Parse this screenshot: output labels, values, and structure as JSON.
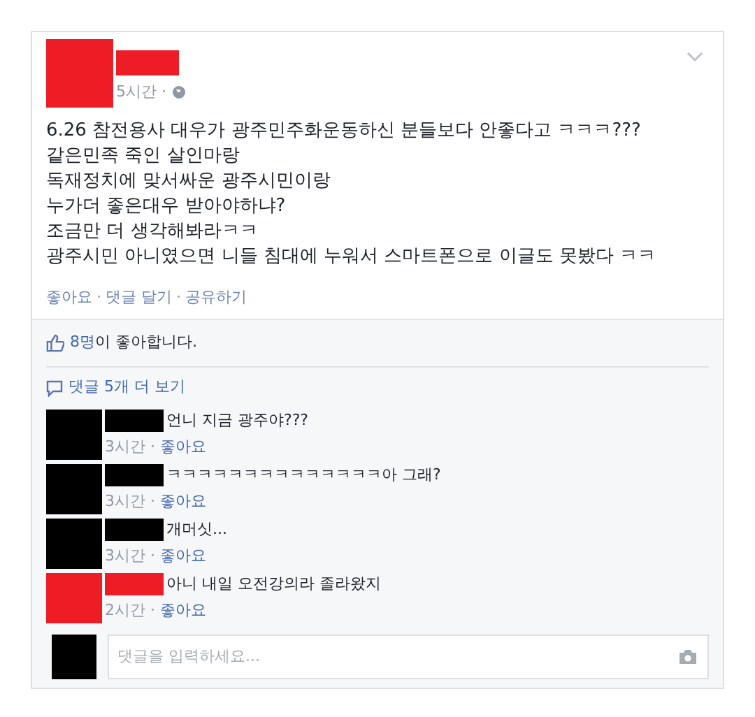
{
  "post": {
    "color": "#ee1c25",
    "time": "5시간 · ",
    "lines": [
      "6.26 참전용사 대우가 광주민주화운동하신 분들보다 안좋다고 ㅋㅋㅋ???",
      "같은민족 죽인 살인마랑",
      "독재정치에 맞서싸운 광주시민이랑",
      "누가더 좋은대우 받아야하냐?",
      "조금만 더 생각해봐라ㅋㅋ",
      "광주시민 아니였으면 니들 침대에 누워서 스마트폰으로 이글도 못봤다 ㅋㅋ"
    ],
    "actions": [
      "좋아요",
      "댓글 달기",
      "공유하기"
    ],
    "separator": "·"
  },
  "likes": {
    "count": "8명",
    "text": "이 좋아합니다."
  },
  "more_comments": "댓글 5개 더 보기",
  "comments": [
    {
      "color": "#000000",
      "text": "언니 지금 광주야???",
      "time": "3시간 · ",
      "like": "좋아요"
    },
    {
      "color": "#000000",
      "text": "ㅋㅋㅋㅋㅋㅋㅋㅋㅋㅋㅋㅋㅋㅋ아 그래?",
      "time": "3시간 · ",
      "like": "좋아요"
    },
    {
      "color": "#000000",
      "text": "개머싯...",
      "time": "3시간 · ",
      "like": "좋아요"
    },
    {
      "color": "#ee1c25",
      "text": "아니 내일 오전강의라 졸라왔지",
      "time": "2시간 · ",
      "like": "좋아요"
    }
  ],
  "comment_input": {
    "placeholder": "댓글을 입력하세요..."
  }
}
